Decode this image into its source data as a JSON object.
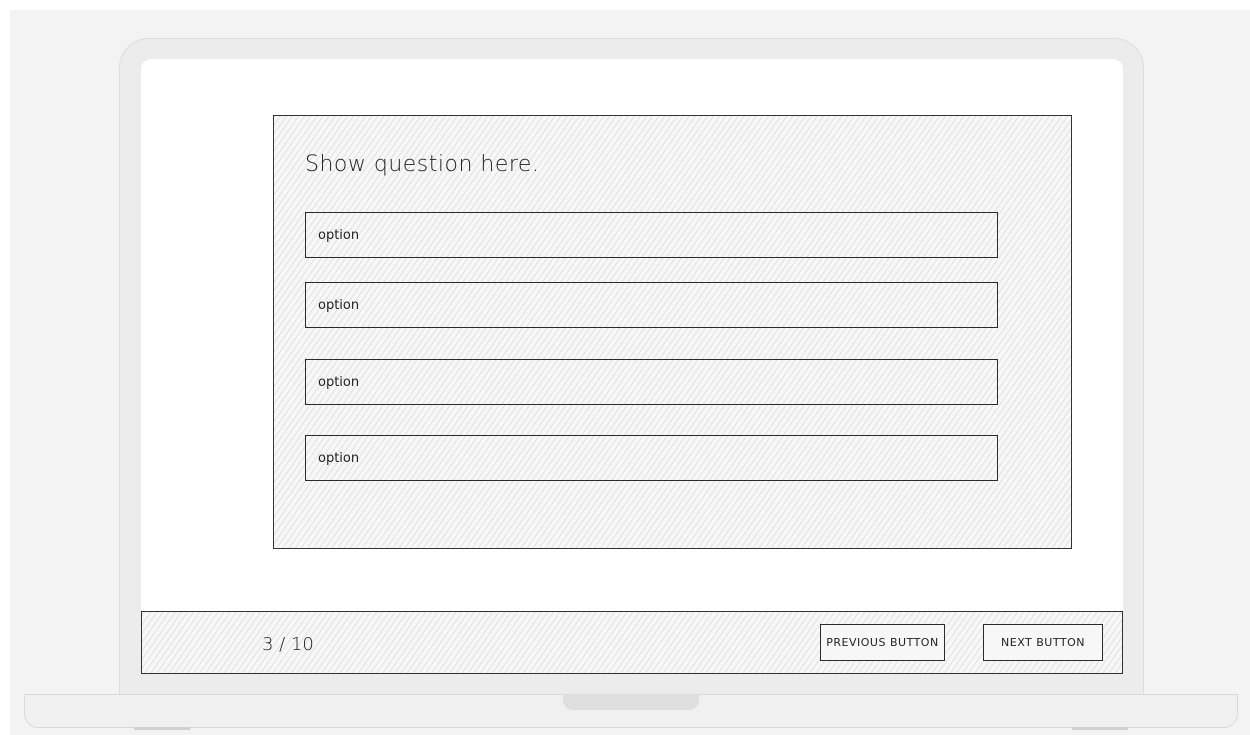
{
  "quiz": {
    "question": "Show question here.",
    "options": [
      {
        "label": "option"
      },
      {
        "label": "option"
      },
      {
        "label": "option"
      },
      {
        "label": "option"
      }
    ]
  },
  "footer": {
    "progress_text": "3 / 10",
    "current": 3,
    "total": 10,
    "previous_label": "PREVIOUS BUTTON",
    "next_label": "NEXT BUTTON"
  }
}
